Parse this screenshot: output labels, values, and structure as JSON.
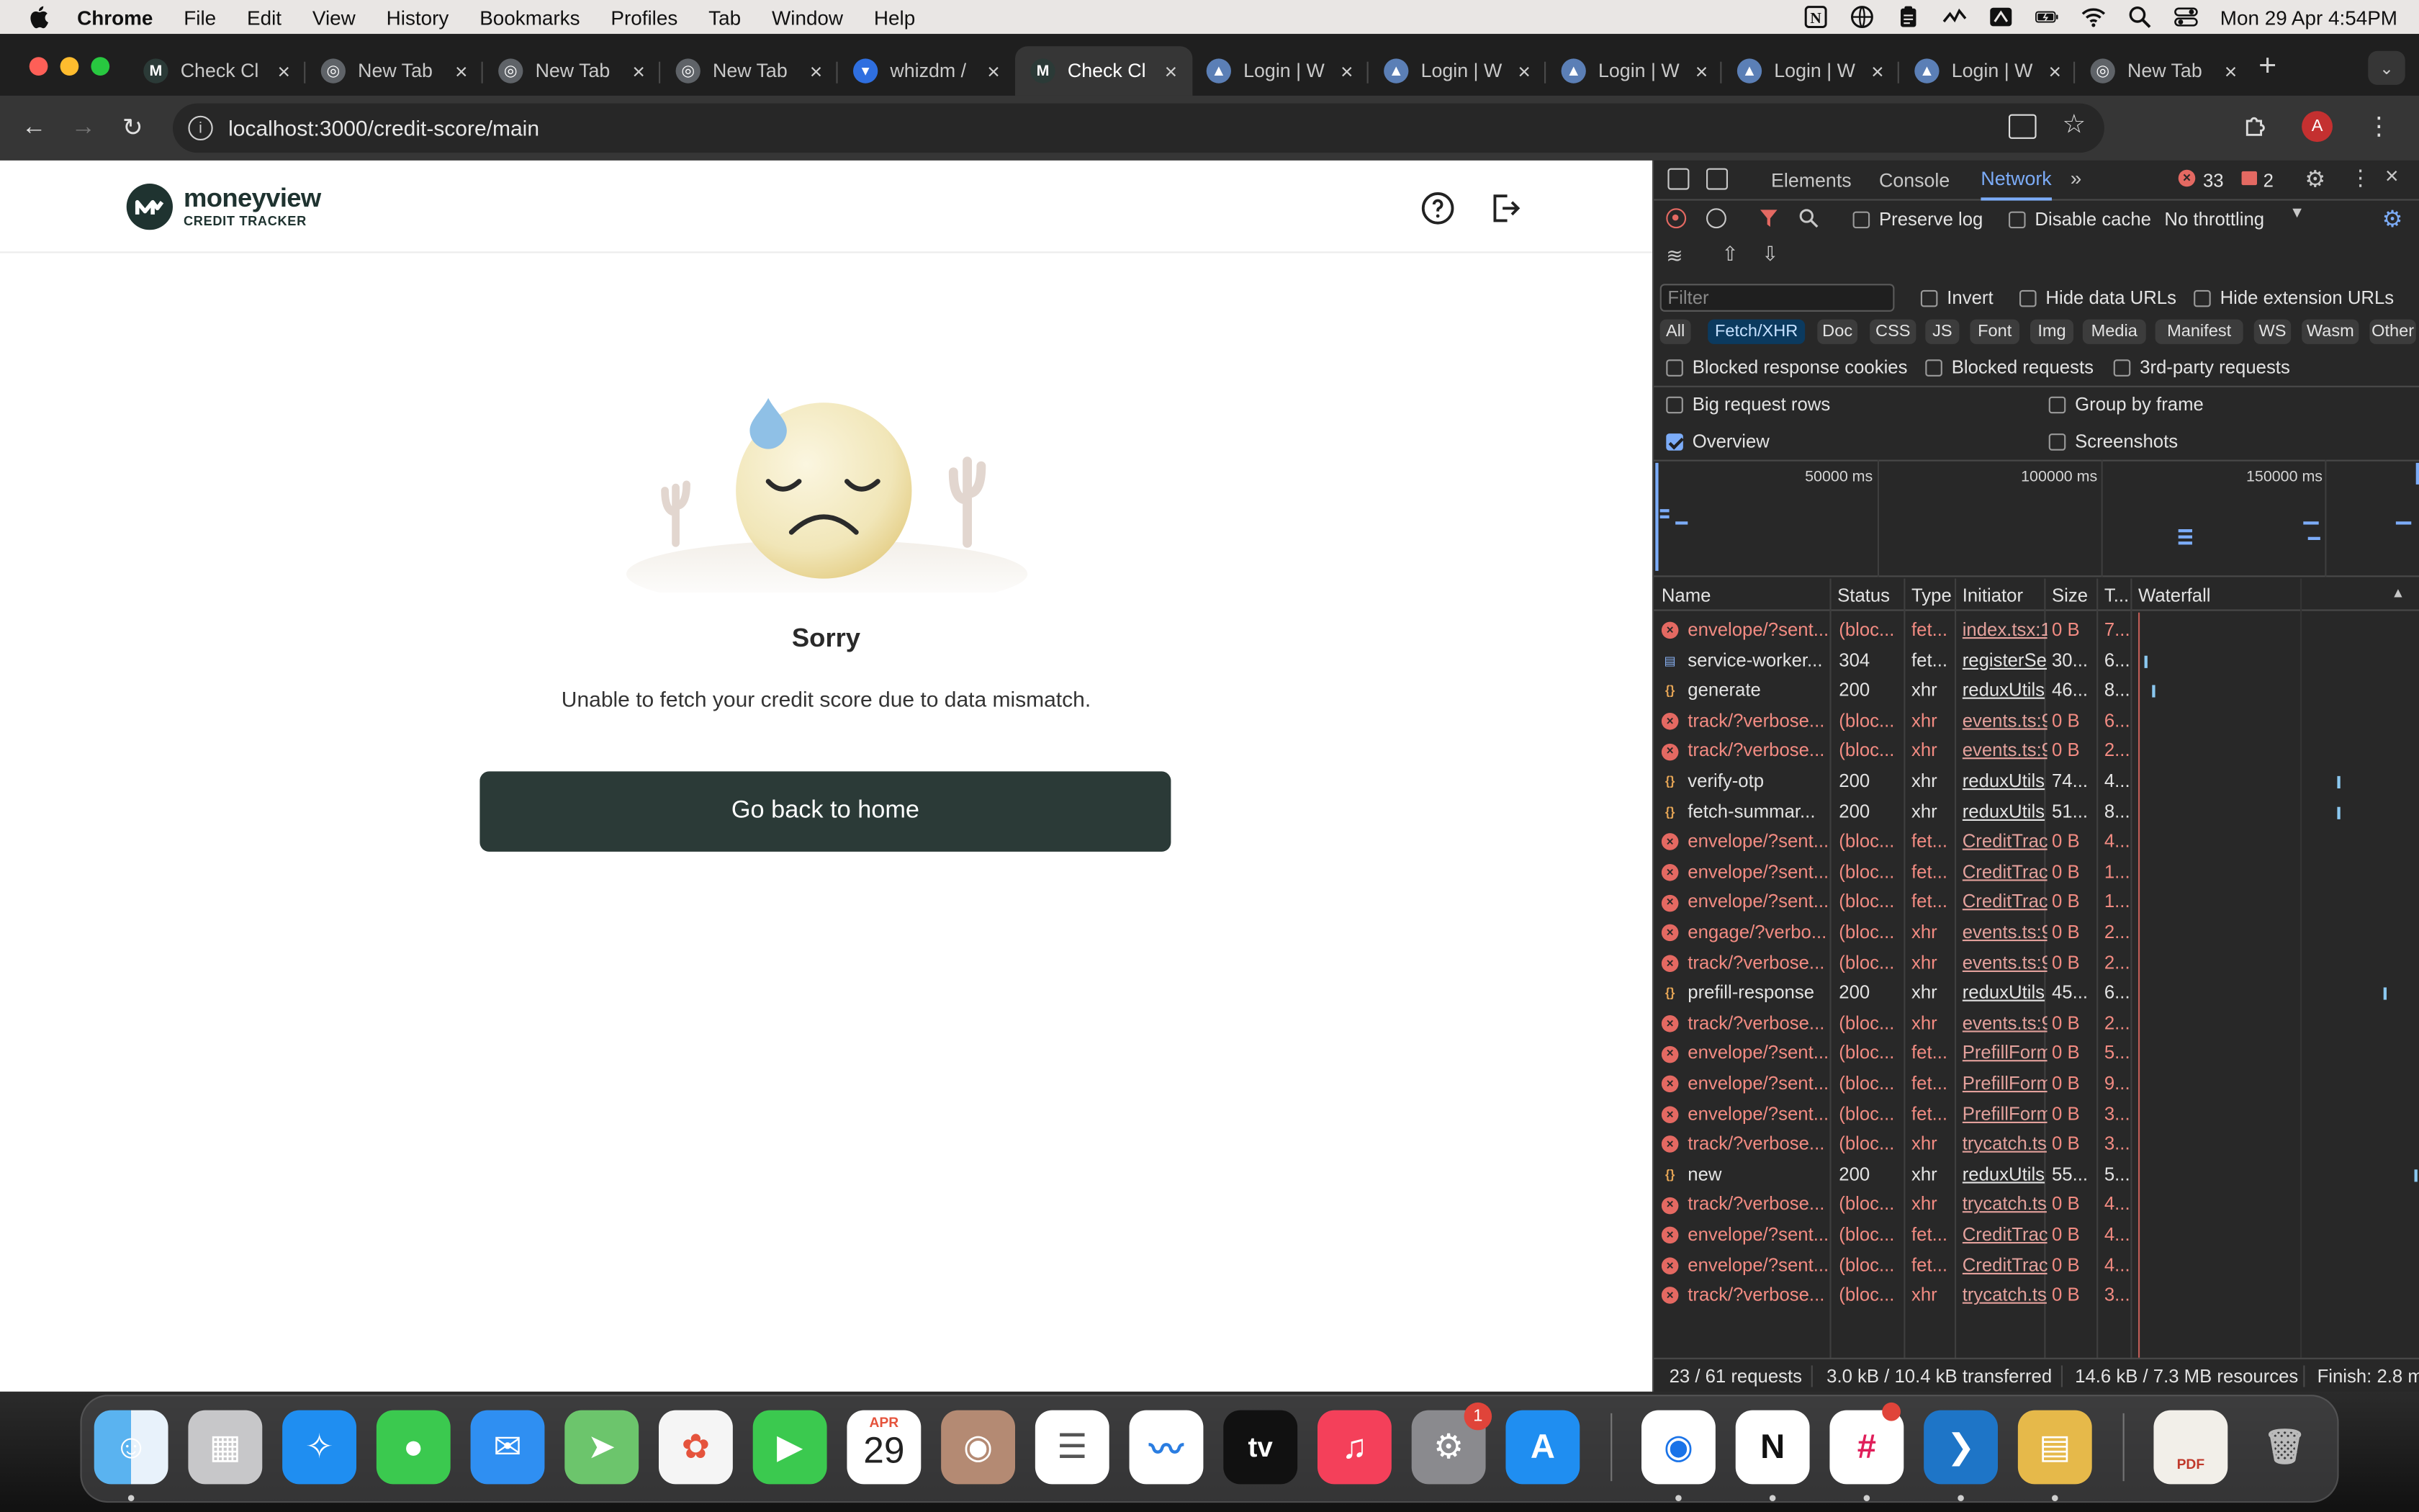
{
  "menubar": {
    "app": "Chrome",
    "items": [
      "File",
      "Edit",
      "View",
      "History",
      "Bookmarks",
      "Profiles",
      "Tab",
      "Window",
      "Help"
    ],
    "clock": "Mon 29 Apr  4:54PM"
  },
  "tabs": [
    {
      "title": "Check Cl",
      "favicon": "moneyview-icon",
      "active": false
    },
    {
      "title": "New Tab",
      "favicon": "chrome-icon",
      "active": false
    },
    {
      "title": "New Tab",
      "favicon": "chrome-icon",
      "active": false
    },
    {
      "title": "New Tab",
      "favicon": "chrome-icon",
      "active": false
    },
    {
      "title": "whizdm /",
      "favicon": "bitbucket-icon",
      "active": false
    },
    {
      "title": "Check Cl",
      "favicon": "moneyview-icon",
      "active": true
    },
    {
      "title": "Login | W",
      "favicon": "login-icon",
      "active": false
    },
    {
      "title": "Login | W",
      "favicon": "login-icon",
      "active": false
    },
    {
      "title": "Login | W",
      "favicon": "login-icon",
      "active": false
    },
    {
      "title": "Login | W",
      "favicon": "login-icon",
      "active": false
    },
    {
      "title": "Login | W",
      "favicon": "login-icon",
      "active": false
    },
    {
      "title": "New Tab",
      "favicon": "chrome-icon",
      "active": false
    }
  ],
  "omnibox": {
    "url": "localhost:3000/credit-score/main"
  },
  "app": {
    "brand": "moneyview",
    "brand_sub": "CREDIT TRACKER",
    "title": "Sorry",
    "message": "Unable to fetch your credit score due to data mismatch.",
    "button": "Go back to home"
  },
  "devtools": {
    "tabs": [
      "Elements",
      "Console",
      "Network"
    ],
    "active_tab": "Network",
    "errors": "33",
    "warnings": "2",
    "preserve_log": "Preserve log",
    "disable_cache": "Disable cache",
    "throttling": "No throttling",
    "filter_placeholder": "Filter",
    "invert": "Invert",
    "hide_data_urls": "Hide data URLs",
    "hide_ext_urls": "Hide extension URLs",
    "type_filters": [
      "All",
      "Fetch/XHR",
      "Doc",
      "CSS",
      "JS",
      "Font",
      "Img",
      "Media",
      "Manifest",
      "WS",
      "Wasm",
      "Other"
    ],
    "active_filter": "Fetch/XHR",
    "blocked_cookies": "Blocked response cookies",
    "blocked_requests": "Blocked requests",
    "third_party": "3rd-party requests",
    "big_rows": "Big request rows",
    "group_by_frame": "Group by frame",
    "overview": "Overview",
    "overview_checked": true,
    "screenshots": "Screenshots",
    "timeline_labels": [
      "50000 ms",
      "100000 ms",
      "150000 ms"
    ],
    "columns": [
      "Name",
      "Status",
      "Type",
      "Initiator",
      "Size",
      "T...",
      "Waterfall"
    ],
    "requests": [
      {
        "name": "envelope/?sent...",
        "status": "(bloc...",
        "type": "fet...",
        "initiator": "index.tsx:1",
        "size": "0 B",
        "time": "7...",
        "kind": "err",
        "wf": null
      },
      {
        "name": "service-worker...",
        "status": "304",
        "type": "fet...",
        "initiator": "registerSe",
        "size": "30...",
        "time": "6...",
        "kind": "doc",
        "wf": 0.02
      },
      {
        "name": "generate",
        "status": "200",
        "type": "xhr",
        "initiator": "reduxUtils",
        "size": "46...",
        "time": "8...",
        "kind": "xhr",
        "wf": 0.05
      },
      {
        "name": "track/?verbose...",
        "status": "(bloc...",
        "type": "xhr",
        "initiator": "events.ts:9",
        "size": "0 B",
        "time": "6...",
        "kind": "err",
        "wf": null
      },
      {
        "name": "track/?verbose...",
        "status": "(bloc...",
        "type": "xhr",
        "initiator": "events.ts:9",
        "size": "0 B",
        "time": "2...",
        "kind": "err",
        "wf": null
      },
      {
        "name": "verify-otp",
        "status": "200",
        "type": "xhr",
        "initiator": "reduxUtils",
        "size": "74...",
        "time": "4...",
        "kind": "xhr",
        "wf": 0.71
      },
      {
        "name": "fetch-summar...",
        "status": "200",
        "type": "xhr",
        "initiator": "reduxUtils",
        "size": "51...",
        "time": "8...",
        "kind": "xhr",
        "wf": 0.71
      },
      {
        "name": "envelope/?sent...",
        "status": "(bloc...",
        "type": "fet...",
        "initiator": "CreditTrac",
        "size": "0 B",
        "time": "4...",
        "kind": "err",
        "wf": null
      },
      {
        "name": "envelope/?sent...",
        "status": "(bloc...",
        "type": "fet...",
        "initiator": "CreditTrac",
        "size": "0 B",
        "time": "1...",
        "kind": "err",
        "wf": null
      },
      {
        "name": "envelope/?sent...",
        "status": "(bloc...",
        "type": "fet...",
        "initiator": "CreditTrac",
        "size": "0 B",
        "time": "1...",
        "kind": "err",
        "wf": null
      },
      {
        "name": "engage/?verbo...",
        "status": "(bloc...",
        "type": "xhr",
        "initiator": "events.ts:9",
        "size": "0 B",
        "time": "2...",
        "kind": "err",
        "wf": null
      },
      {
        "name": "track/?verbose...",
        "status": "(bloc...",
        "type": "xhr",
        "initiator": "events.ts:9",
        "size": "0 B",
        "time": "2...",
        "kind": "err",
        "wf": null
      },
      {
        "name": "prefill-response",
        "status": "200",
        "type": "xhr",
        "initiator": "reduxUtils",
        "size": "45...",
        "time": "6...",
        "kind": "xhr",
        "wf": 0.88
      },
      {
        "name": "track/?verbose...",
        "status": "(bloc...",
        "type": "xhr",
        "initiator": "events.ts:9",
        "size": "0 B",
        "time": "2...",
        "kind": "err",
        "wf": null
      },
      {
        "name": "envelope/?sent...",
        "status": "(bloc...",
        "type": "fet...",
        "initiator": "PrefillForm",
        "size": "0 B",
        "time": "5...",
        "kind": "err",
        "wf": null
      },
      {
        "name": "envelope/?sent...",
        "status": "(bloc...",
        "type": "fet...",
        "initiator": "PrefillForm",
        "size": "0 B",
        "time": "9...",
        "kind": "err",
        "wf": null
      },
      {
        "name": "envelope/?sent...",
        "status": "(bloc...",
        "type": "fet...",
        "initiator": "PrefillForm",
        "size": "0 B",
        "time": "3...",
        "kind": "err",
        "wf": null
      },
      {
        "name": "track/?verbose...",
        "status": "(bloc...",
        "type": "xhr",
        "initiator": "trycatch.ts",
        "size": "0 B",
        "time": "3...",
        "kind": "err",
        "wf": null
      },
      {
        "name": "new",
        "status": "200",
        "type": "xhr",
        "initiator": "reduxUtils",
        "size": "55...",
        "time": "5...",
        "kind": "xhr",
        "wf": 0.99
      },
      {
        "name": "track/?verbose...",
        "status": "(bloc...",
        "type": "xhr",
        "initiator": "trycatch.ts",
        "size": "0 B",
        "time": "4...",
        "kind": "err",
        "wf": null
      },
      {
        "name": "envelope/?sent...",
        "status": "(bloc...",
        "type": "fet...",
        "initiator": "CreditTrac",
        "size": "0 B",
        "time": "4...",
        "kind": "err",
        "wf": null
      },
      {
        "name": "envelope/?sent...",
        "status": "(bloc...",
        "type": "fet...",
        "initiator": "CreditTrac",
        "size": "0 B",
        "time": "4...",
        "kind": "err",
        "wf": null
      },
      {
        "name": "track/?verbose...",
        "status": "(bloc...",
        "type": "xhr",
        "initiator": "trycatch.ts",
        "size": "0 B",
        "time": "3...",
        "kind": "err",
        "wf": null
      }
    ],
    "summary": {
      "requests": "23 / 61 requests",
      "transferred": "3.0 kB / 10.4 kB transferred",
      "resources": "14.6 kB / 7.3 MB resources",
      "finish": "Finish: 2.8 m"
    }
  },
  "dock": {
    "calendar_month": "APR",
    "calendar_day": "29",
    "settings_badge": "1",
    "appletv": "tv",
    "pdf_label": "PDF",
    "items": [
      "finder",
      "launchpad",
      "safari",
      "messages",
      "mail",
      "maps",
      "photos",
      "facetime",
      "calendar",
      "contacts",
      "reminders",
      "freeform",
      "appletv",
      "music",
      "system-settings",
      "app-store",
      "chrome",
      "notion",
      "slack",
      "vscode",
      "sequel",
      "certificate-pdf",
      "trash"
    ]
  },
  "colors": {
    "accent": "#7cacf8",
    "button": "#2b3a37",
    "error": "#f28b82"
  }
}
